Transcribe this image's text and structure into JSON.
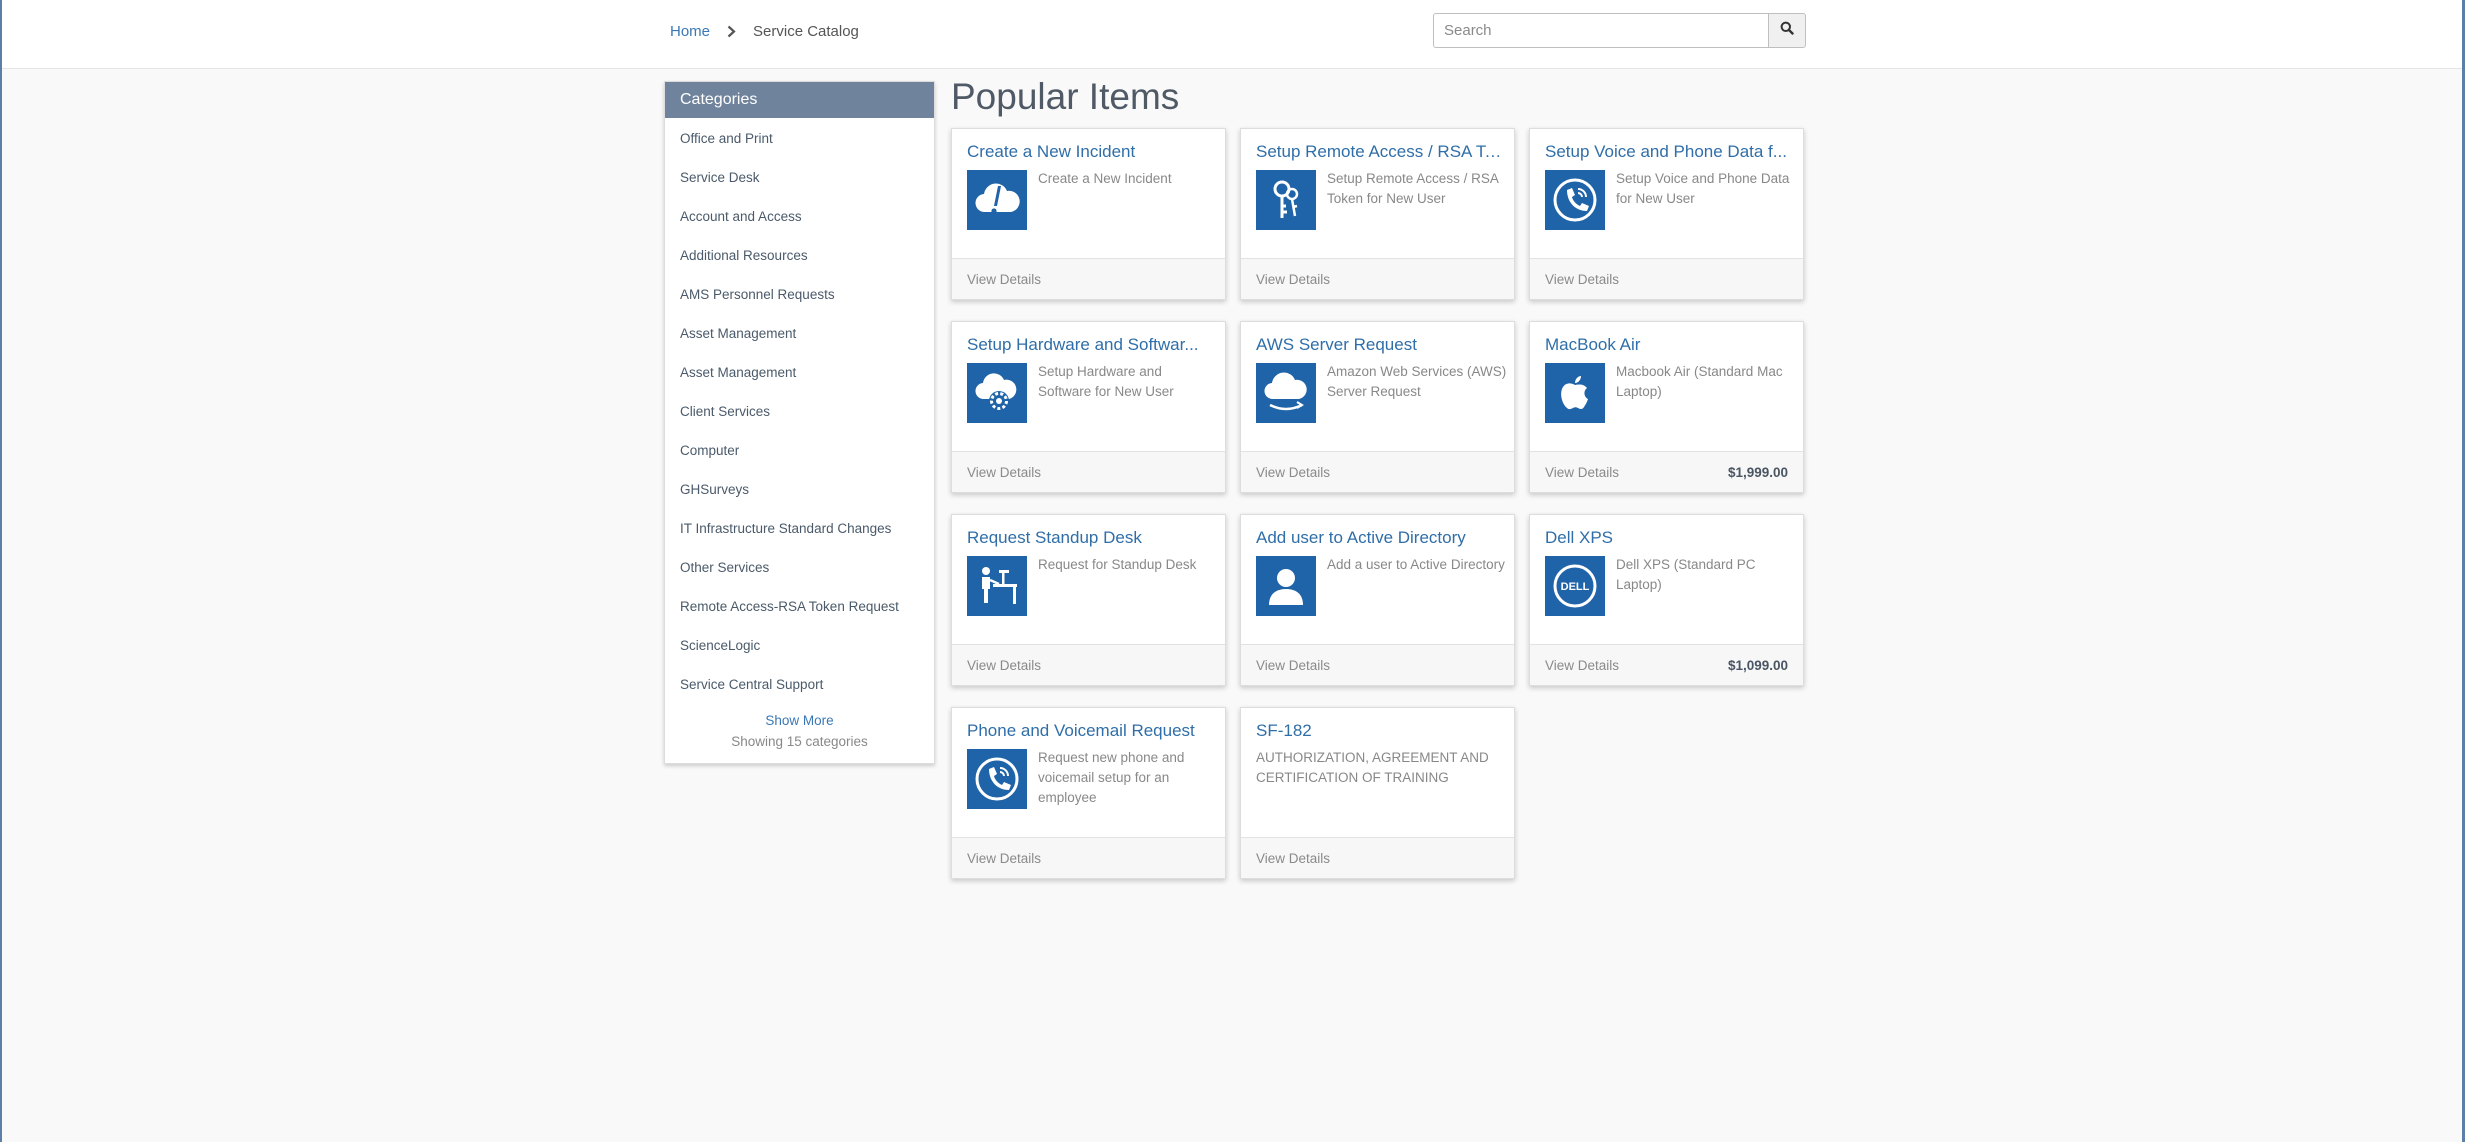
{
  "breadcrumb": {
    "home": "Home",
    "current": "Service Catalog"
  },
  "search": {
    "placeholder": "Search"
  },
  "sidebar": {
    "title": "Categories",
    "items": [
      "Office and Print",
      "Service Desk",
      "Account and Access",
      "Additional Resources",
      "AMS Personnel Requests",
      "Asset Management",
      "Asset Management",
      "Client Services",
      "Computer",
      "GHSurveys",
      "IT Infrastructure Standard Changes",
      "Other Services",
      "Remote Access-RSA Token Request",
      "ScienceLogic",
      "Service Central Support"
    ],
    "show_more": "Show More",
    "showing": "Showing 15 categories"
  },
  "main": {
    "title": "Popular Items",
    "cards": [
      {
        "title": "Create a New Incident",
        "desc": "Create a New Incident",
        "footer": "View Details",
        "price": "",
        "icon": "incident-cloud-icon"
      },
      {
        "title": "Setup Remote Access / RSA To...",
        "desc": "Setup Remote Access / RSA Token for New User",
        "footer": "View Details",
        "price": "",
        "icon": "keys-icon"
      },
      {
        "title": "Setup Voice and Phone Data f...",
        "desc": "Setup Voice and Phone Data for New User",
        "footer": "View Details",
        "price": "",
        "icon": "phone-icon"
      },
      {
        "title": "Setup Hardware and Softwar...",
        "desc": "Setup Hardware and Software for New User",
        "footer": "View Details",
        "price": "",
        "icon": "cloud-gear-icon"
      },
      {
        "title": "AWS Server Request",
        "desc": "Amazon Web Services (AWS) Server Request",
        "footer": "View Details",
        "price": "",
        "icon": "aws-cloud-icon"
      },
      {
        "title": "MacBook Air",
        "desc": "Macbook Air (Standard Mac Laptop)",
        "footer": "View Details",
        "price": "$1,999.00",
        "icon": "apple-icon"
      },
      {
        "title": "Request Standup Desk",
        "desc": "Request for Standup Desk",
        "footer": "View Details",
        "price": "",
        "icon": "standup-desk-icon"
      },
      {
        "title": "Add user to Active Directory",
        "desc": "Add a user to Active Directory",
        "footer": "View Details",
        "price": "",
        "icon": "user-icon"
      },
      {
        "title": "Dell XPS",
        "desc": "Dell XPS (Standard PC Laptop)",
        "footer": "View Details",
        "price": "$1,099.00",
        "icon": "dell-icon"
      },
      {
        "title": "Phone and Voicemail Request",
        "desc": "Request new phone and voicemail setup for an employee",
        "footer": "View Details",
        "price": "",
        "icon": "phone-icon"
      },
      {
        "title": "SF-182",
        "desc": "AUTHORIZATION, AGREEMENT AND CERTIFICATION OF TRAINING",
        "footer": "View Details",
        "price": "",
        "icon": ""
      }
    ]
  }
}
